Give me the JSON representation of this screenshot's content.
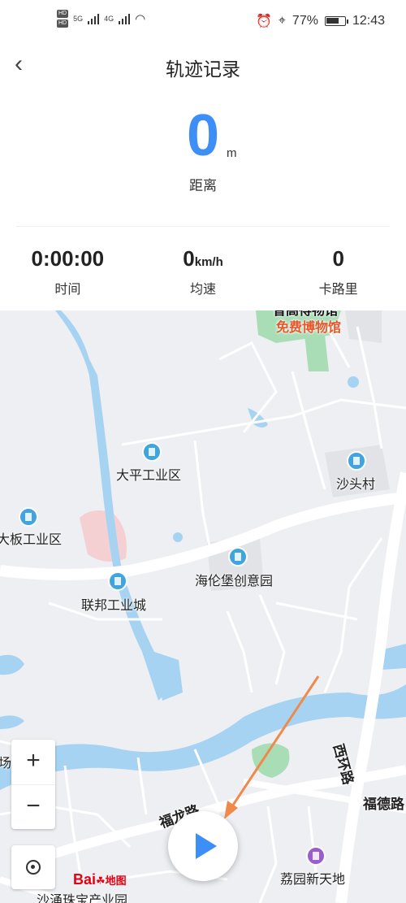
{
  "status_bar": {
    "hd1": "HD",
    "hd2": "HD",
    "net1": "5G",
    "net2": "4G",
    "battery_percent": "77%",
    "time": "12:43",
    "battery_level": 0.77
  },
  "header": {
    "title": "轨迹记录"
  },
  "distance": {
    "value": "0",
    "unit": "m",
    "label": "距离"
  },
  "stats": [
    {
      "value": "0:00:00",
      "unit": "",
      "label": "时间"
    },
    {
      "value": "0",
      "unit": "km/h",
      "label": "均速"
    },
    {
      "value": "0",
      "unit": "",
      "label": "卡路里"
    }
  ],
  "map": {
    "pois": [
      "免费博物馆",
      "大平工业区",
      "沙头村",
      "大板工业区",
      "海伦堡创意园",
      "联邦工业城",
      "荔园新天地"
    ],
    "roads": [
      "西环路",
      "福德路",
      "福龙路"
    ],
    "edge_labels": [
      "场",
      "曾高得物馆",
      "沙涌珠宝产业园"
    ],
    "zoom_in": "+",
    "zoom_out": "−",
    "logo_text": "Bai",
    "logo_suffix": "地图"
  },
  "colors": {
    "accent": "#3d8ef7",
    "map_bg": "#eeeff2",
    "water": "#a6d3f2",
    "poi_pin": "#3fa4e0",
    "annotation_arrow": "#f08a4b"
  }
}
